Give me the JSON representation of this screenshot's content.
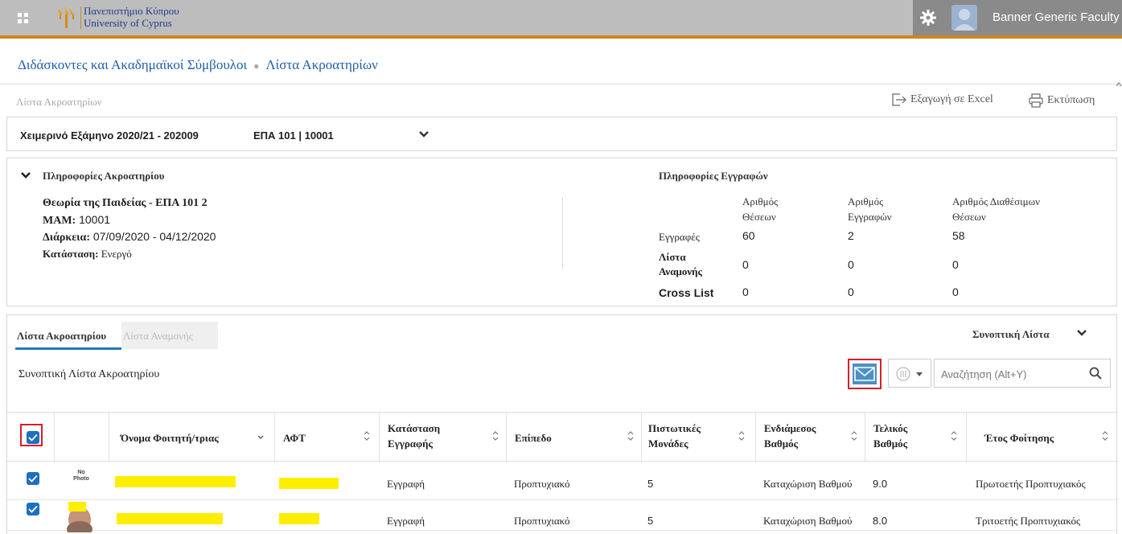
{
  "header": {
    "university_greek": "Πανεπιστήμιο Κύπρου",
    "university_english": "University of Cyprus",
    "user_name": "Banner Generic Faculty",
    "colors": {
      "bar": "#bdbdbd",
      "accent": "#c98a1a",
      "user_area": "#8a8a8a"
    }
  },
  "breadcrumb": {
    "root": "Διδάσκοντες και Ακαδημαϊκοί Σύμβουλοι",
    "current": "Λίστα Ακροατηρίων"
  },
  "page": {
    "subtitle": "Λίστα Ακροατηρίων",
    "export_label": "Εξαγωγή σε Excel",
    "print_label": "Εκτύπωση"
  },
  "term": {
    "term_label": "Χειμερινό Εξάμηνο 2020/21 - 202009",
    "crn_label": "ΕΠΑ 101 | 10001"
  },
  "course_info": {
    "section_title": "Πληροφορίες Ακροατηρίου",
    "course_title": "Θεωρία της Παιδείας - ΕΠΑ 101 2",
    "mam_label": "ΜΑΜ:",
    "mam_value": "10001",
    "duration_label": "Διάρκεια:",
    "duration_value": "07/09/2020 - 04/12/2020",
    "status_label": "Κατάσταση:",
    "status_value": "Ενεργό"
  },
  "enrollment_info": {
    "section_title": "Πληροφορίες Εγγραφών",
    "col_seats": [
      "Αριθμός",
      "Θέσεων"
    ],
    "col_enrolled": [
      "Αριθμός",
      "Εγγραφών"
    ],
    "col_available": [
      "Αριθμός Διαθέσιμων",
      "Θέσεων"
    ],
    "rows": [
      {
        "label": "Εγγραφές",
        "seats": "60",
        "enrolled": "2",
        "available": "58"
      },
      {
        "label": "Λίστα Αναμονής",
        "seats": "0",
        "enrolled": "0",
        "available": "0"
      },
      {
        "label": "Cross List",
        "seats": "0",
        "enrolled": "0",
        "available": "0"
      }
    ]
  },
  "roster": {
    "tab_roster": "Λίστα Ακροατηρίου",
    "tab_waitlist": "Λίστα Αναμονής",
    "summary_toggle": "Συνοπτική Λίστα",
    "list_title": "Συνοπτική Λίστα Ακροατηρίου",
    "search_placeholder": "Αναζήτηση (Alt+Y)",
    "columns": {
      "name": "Όνομα Φοιτητή/τριας",
      "aft": "ΑΦΤ",
      "registration_status": [
        "Κατάσταση",
        "Εγγραφής"
      ],
      "level": "Επίπεδο",
      "credits": [
        "Πιστωτικές",
        "Μονάδες"
      ],
      "midterm": [
        "Ενδιάμεσος",
        "Βαθμός"
      ],
      "final": [
        "Τελικός",
        "Βαθμός"
      ],
      "year": "Έτος Φοίτησης"
    },
    "rows": [
      {
        "photo": "No Photo",
        "registration_status": "Εγγραφή",
        "level": "Προπτυχιακό",
        "credits": "5",
        "midterm": "Καταχώριση Βαθμού",
        "final": "9.0",
        "year": "Πρωτοετής Προπτυχιακός"
      },
      {
        "photo": "",
        "registration_status": "Εγγραφή",
        "level": "Προπτυχιακό",
        "credits": "5",
        "midterm": "Καταχώριση Βαθμού",
        "final": "8.0",
        "year": "Τριτοετής Προπτυχιακός"
      }
    ],
    "colors": {
      "tab_active": "#1f7ac2",
      "email": "#4d90c6",
      "highlight_frame": "#d81f26",
      "redaction": "#ffee00"
    }
  }
}
